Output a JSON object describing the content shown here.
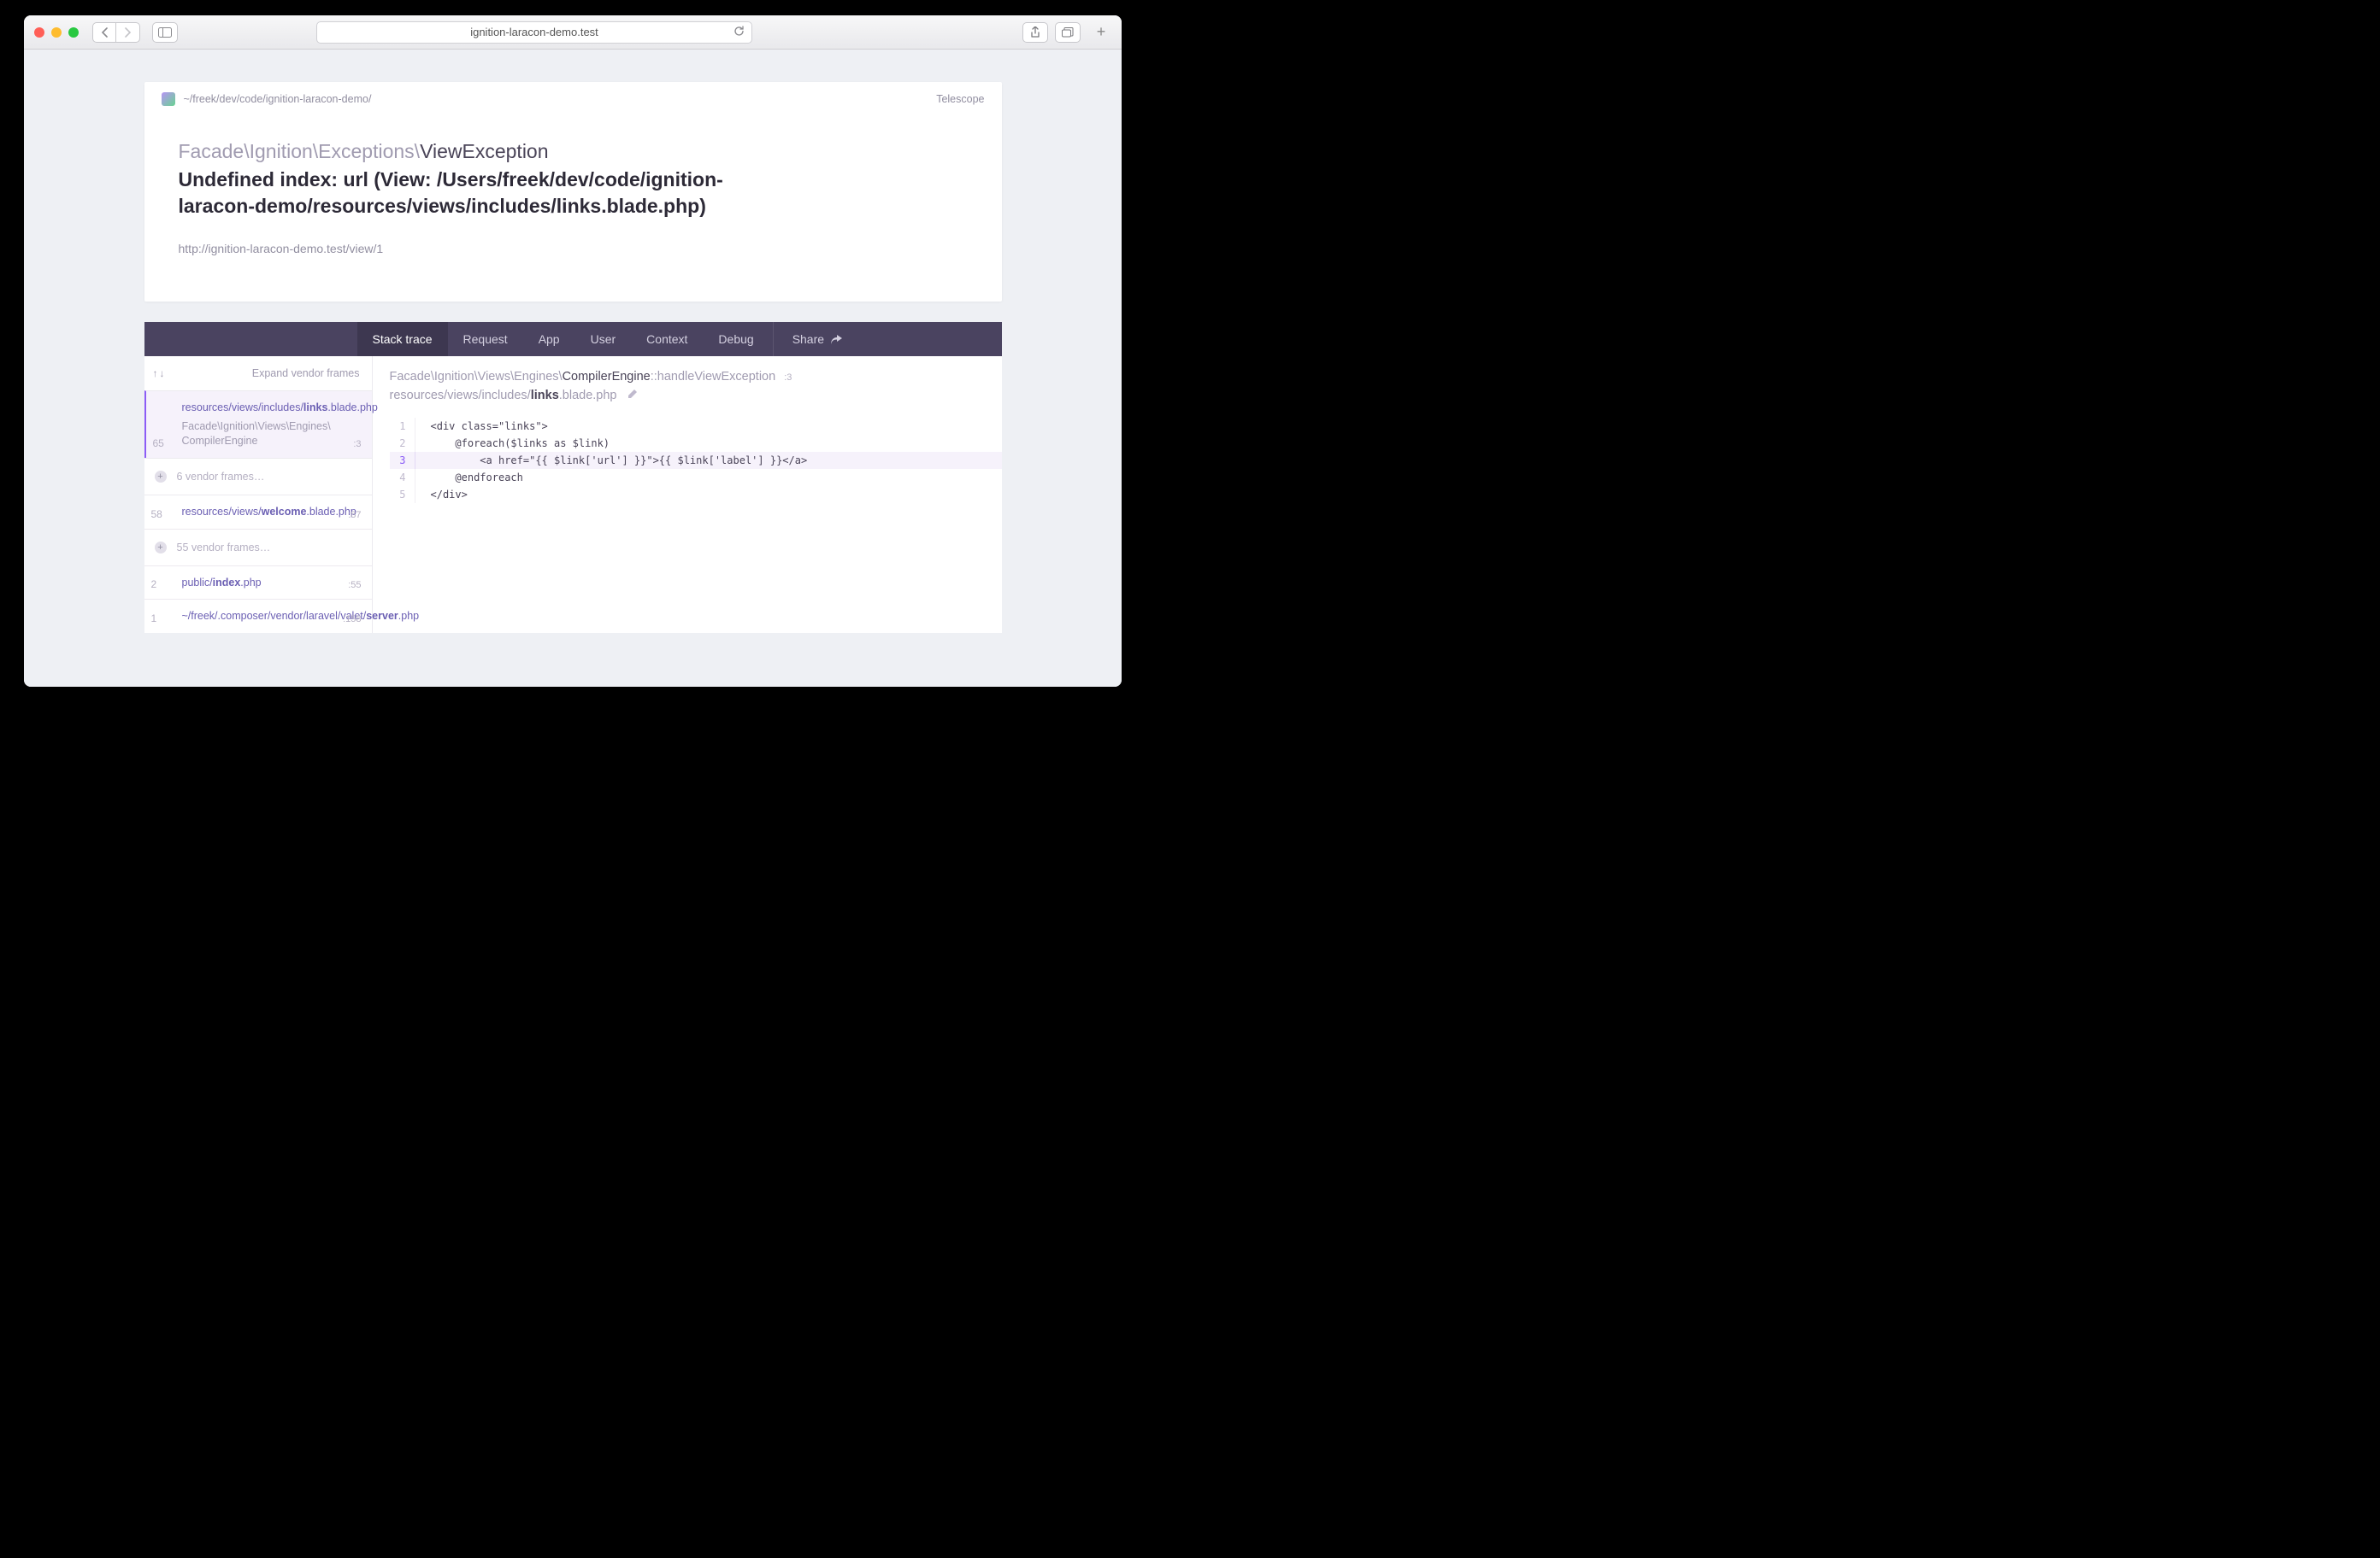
{
  "browser": {
    "address": "ignition-laracon-demo.test"
  },
  "header": {
    "project_path": "~/freek/dev/code/ignition-laracon-demo/",
    "telescope": "Telescope"
  },
  "exception": {
    "namespace": "Facade\\Ignition\\Exceptions\\",
    "class": "ViewException",
    "message": "Undefined index: url (View: /Users/freek/dev/code/ignition-laracon-demo/resources/views/includes/links.blade.php)",
    "url": "http://ignition-laracon-demo.test/view/1"
  },
  "tabs": {
    "stack": "Stack trace",
    "request": "Request",
    "app": "App",
    "user": "User",
    "context": "Context",
    "debug": "Debug",
    "share": "Share"
  },
  "frames_header": {
    "expand": "Expand vendor frames"
  },
  "frames": [
    {
      "line": "65",
      "path_prefix": "resources/views/includes/",
      "path_bold": "links",
      "path_suffix": ".blade.php",
      "sub": "Facade\\Ignition\\Views\\Engines\\CompilerEngine",
      "col": ":3"
    },
    {
      "vendor": "6 vendor frames…"
    },
    {
      "line": "58",
      "path_prefix": "resources/views/",
      "path_bold": "welcome",
      "path_suffix": ".blade.php",
      "col": ":87"
    },
    {
      "vendor": "55 vendor frames…"
    },
    {
      "line": "2",
      "path_prefix": "public/",
      "path_bold": "index",
      "path_suffix": ".php",
      "col": ":55"
    },
    {
      "line": "1",
      "path_prefix": "~/freek/.composer/vendor/laravel/valet/",
      "path_bold": "server",
      "path_suffix": ".php",
      "col": ":158"
    }
  ],
  "code_header": {
    "ns_gray": "Facade\\Ignition\\Views\\Engines\\",
    "ns_dark": "CompilerEngine",
    "ns_sep": "::",
    "ns_method": "handleViewException",
    "line_badge": ":3",
    "path_prefix": "resources/views/includes/",
    "path_bold": "links",
    "path_suffix": ".blade.php"
  },
  "source": [
    {
      "n": "1",
      "t": "<div class=\"links\">"
    },
    {
      "n": "2",
      "t": "    @foreach($links as $link)"
    },
    {
      "n": "3",
      "t": "        <a href=\"{{ $link['url'] }}\">{{ $link['label'] }}</a>",
      "hl": true
    },
    {
      "n": "4",
      "t": "    @endforeach"
    },
    {
      "n": "5",
      "t": "</div>"
    }
  ]
}
